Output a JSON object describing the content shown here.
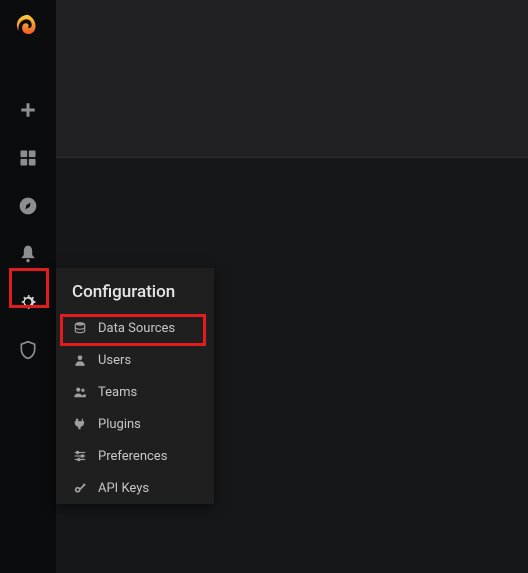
{
  "sidebar": {
    "icons": [
      {
        "name": "plus-icon"
      },
      {
        "name": "dashboards-icon"
      },
      {
        "name": "explore-icon"
      },
      {
        "name": "alerting-icon"
      },
      {
        "name": "configuration-icon"
      },
      {
        "name": "server-admin-icon"
      }
    ]
  },
  "popup": {
    "title": "Configuration",
    "items": [
      {
        "icon": "database-icon",
        "label": "Data Sources"
      },
      {
        "icon": "user-icon",
        "label": "Users"
      },
      {
        "icon": "users-icon",
        "label": "Teams"
      },
      {
        "icon": "plug-icon",
        "label": "Plugins"
      },
      {
        "icon": "sliders-icon",
        "label": "Preferences"
      },
      {
        "icon": "key-icon",
        "label": "API Keys"
      }
    ]
  }
}
